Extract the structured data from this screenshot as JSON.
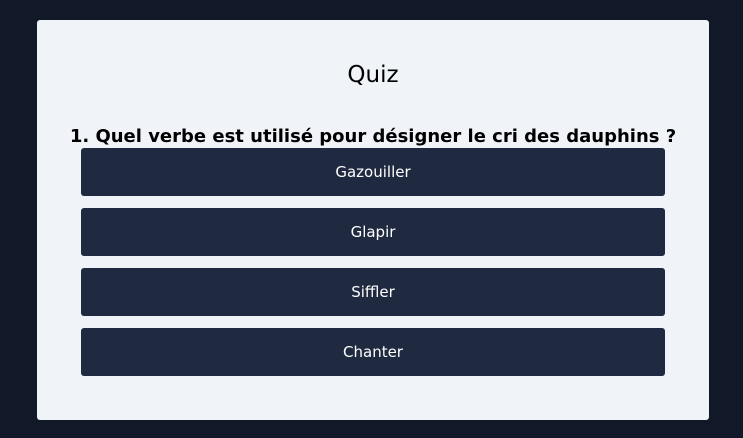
{
  "quiz": {
    "title": "Quiz",
    "question": "1. Quel verbe est utilisé pour désigner le cri des dauphins ?",
    "answers": [
      {
        "label": "Gazouiller"
      },
      {
        "label": "Glapir"
      },
      {
        "label": "Siffler"
      },
      {
        "label": "Chanter"
      }
    ]
  },
  "colors": {
    "page_background": "#111827",
    "card_background": "#f0f4f9",
    "answer_background": "#1f2940",
    "answer_text": "#ffffff"
  }
}
